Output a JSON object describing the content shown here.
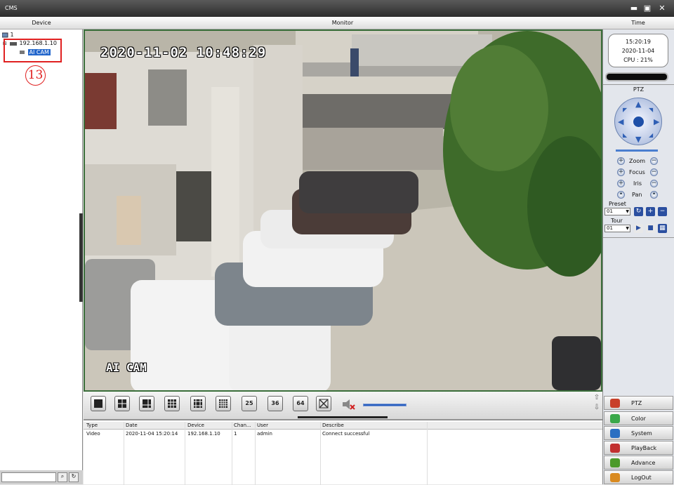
{
  "window": {
    "title": "CMS",
    "minimize": "▬",
    "maximize": "▣",
    "close": "✕"
  },
  "headers": {
    "device": "Device",
    "monitor": "Monitor",
    "time": "Time"
  },
  "tree": {
    "root": "1",
    "device": "192.168.1.10",
    "channel": "AI CAM",
    "callout": "13"
  },
  "video": {
    "osd_time": "2020-11-02 10:48:29",
    "osd_name": "AI CAM"
  },
  "toolbar": {
    "layouts": [
      "25",
      "36",
      "64"
    ]
  },
  "log": {
    "columns": [
      "Type",
      "Date",
      "Device",
      "Chan...",
      "User",
      "Describe"
    ],
    "rows": [
      [
        "Video",
        "2020-11-04 15:20:14",
        "192.168.1.10",
        "1",
        "admin",
        "Connect successful"
      ]
    ]
  },
  "clock": {
    "time": "15:20:19",
    "date": "2020-11-04",
    "cpu": "CPU : 21%"
  },
  "ptz": {
    "title": "PTZ",
    "zoom": "Zoom",
    "focus": "Focus",
    "iris": "Iris",
    "pan": "Pan",
    "preset_label": "Preset",
    "preset_value": "01",
    "tour_label": "Tour",
    "tour_value": "01"
  },
  "menu": [
    {
      "label": "PTZ",
      "color": "#c8402a"
    },
    {
      "label": "Color",
      "color": "#3aa84a"
    },
    {
      "label": "System",
      "color": "#2b6fc2"
    },
    {
      "label": "PlayBack",
      "color": "#c23030"
    },
    {
      "label": "Advance",
      "color": "#4c9a2a"
    },
    {
      "label": "LogOut",
      "color": "#d98a20"
    }
  ]
}
